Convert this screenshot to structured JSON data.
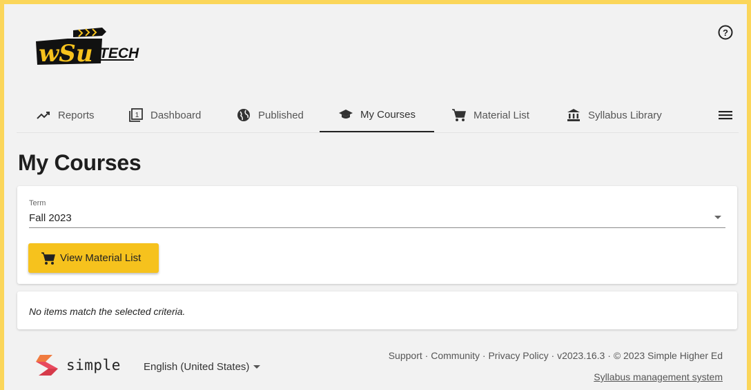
{
  "header": {
    "logo_text": "WSU TECH",
    "help_icon": "help-circle-icon"
  },
  "nav": {
    "tabs": [
      {
        "label": "Reports",
        "icon": "trending-up-icon"
      },
      {
        "label": "Dashboard",
        "icon": "dashboard-1-icon"
      },
      {
        "label": "Published",
        "icon": "globe-icon"
      },
      {
        "label": "My Courses",
        "icon": "graduation-cap-icon",
        "active": true
      },
      {
        "label": "Material List",
        "icon": "cart-icon"
      },
      {
        "label": "Syllabus Library",
        "icon": "library-icon"
      }
    ],
    "menu_icon": "hamburger-menu-icon"
  },
  "page": {
    "title": "My Courses"
  },
  "filters": {
    "term_label": "Term",
    "term_value": "Fall 2023",
    "view_button_label": "View Material List"
  },
  "results": {
    "empty_message": "No items match the selected criteria."
  },
  "footer": {
    "brand": "simple",
    "language": "English (United States)",
    "links": [
      "Support",
      "Community",
      "Privacy Policy"
    ],
    "version": "v2023.16.3",
    "copyright": "© 2023 Simple Higher Ed",
    "system_link": "Syllabus management system"
  },
  "colors": {
    "accent": "#f6c21d",
    "border": "#fbd65a"
  }
}
